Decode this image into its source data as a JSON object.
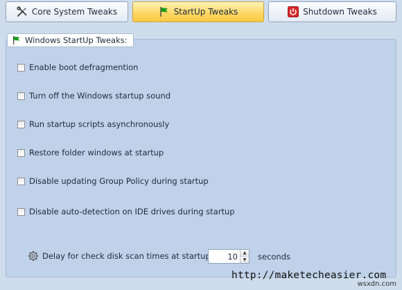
{
  "tabs": [
    {
      "label": "Core System Tweaks",
      "icon": "tools-icon"
    },
    {
      "label": "StartUp Tweaks",
      "icon": "green-flag-icon",
      "active": true
    },
    {
      "label": "Shutdown Tweaks",
      "icon": "power-icon"
    }
  ],
  "group": {
    "title": "Windows StartUp Tweaks:",
    "icon": "green-flag-icon"
  },
  "options": [
    {
      "label": "Enable boot defragmention",
      "checked": false
    },
    {
      "label": "Turn off the Windows startup sound",
      "checked": false
    },
    {
      "label": "Run startup scripts asynchronously",
      "checked": false
    },
    {
      "label": "Restore folder windows at startup",
      "checked": false
    },
    {
      "label": "Disable updating Group Policy during startup",
      "checked": false
    },
    {
      "label": "Disable auto-detection on IDE drives during startup",
      "checked": false
    }
  ],
  "delay": {
    "label": "Delay for check disk scan times at startup:",
    "value": "10",
    "unit": "seconds"
  },
  "watermark": "http://maketecheasier.com",
  "corner_mark": "wsxdn.com",
  "colors": {
    "active_tab": "#fcd868",
    "panel_bg": "#bfd2e9",
    "page_bg": "#cfdcec",
    "flag_green": "#1e9e1e",
    "power_red": "#d42a2a"
  }
}
